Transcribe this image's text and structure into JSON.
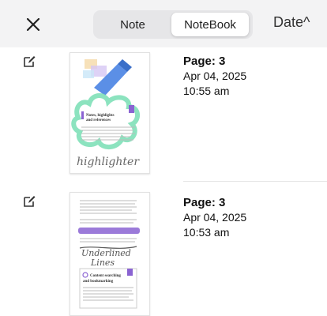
{
  "toolbar": {
    "close_icon": "close-icon",
    "tabs": [
      {
        "label": "Note",
        "active": false
      },
      {
        "label": "NoteBook",
        "active": true
      }
    ],
    "sort_label": "Date^"
  },
  "items": [
    {
      "page": "Page: 3",
      "date": "Apr 04, 2025",
      "time": "10:55 am",
      "thumb_heading": "Notes, highlights and references",
      "thumb_handwriting": "highlighter"
    },
    {
      "page": "Page: 3",
      "date": "Apr 04, 2025",
      "time": "10:53 am",
      "thumb_heading": "Content searching and bookmarking",
      "thumb_handwriting": "Underlined Lines"
    }
  ],
  "colors": {
    "toolbar_bg": "#f3f3f4",
    "highlight_green": "#7fe0b8",
    "highlighter_blue": "#5b8fe6",
    "accent_purple": "#8a63d2"
  }
}
